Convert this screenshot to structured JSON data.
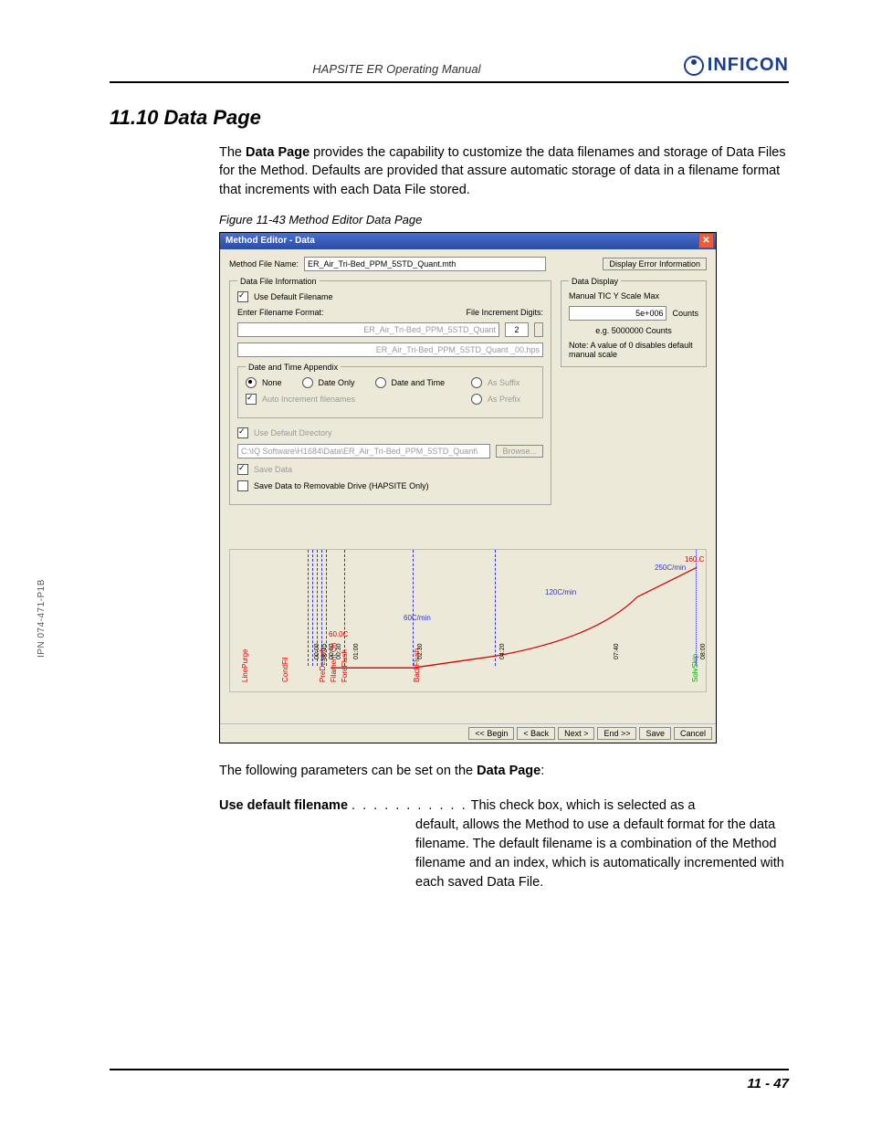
{
  "header": {
    "manual_title": "HAPSITE ER Operating Manual",
    "brand": "INFICON"
  },
  "side_label": "IPN 074-471-P1B",
  "section": {
    "number_title": "11.10  Data Page",
    "intro_1a": "The ",
    "intro_1b": "Data Page",
    "intro_1c": " provides the capability to customize the data filenames and storage of Data Files for the Method. Defaults are provided that assure automatic storage of data in a filename format that increments with each Data File stored.",
    "figure_caption": "Figure 11-43  Method Editor Data Page",
    "outro_1a": "The following parameters can be set on the ",
    "outro_1b": "Data Page",
    "outro_1c": ":"
  },
  "param": {
    "label": "Use default filename",
    "dots": ". . . . . . . . . . .",
    "desc_line1": "This check box, which is selected as a",
    "desc_rest": "default, allows the Method to use a default format for the data filename. The default filename is a combination of the Method filename and an index, which is automatically incremented with each saved Data File."
  },
  "footer": {
    "page": "11 - 47"
  },
  "win": {
    "title": "Method Editor - Data",
    "method_label": "Method File Name:",
    "method_value": "ER_Air_Tri-Bed_PPM_5STD_Quant.mth",
    "display_err_btn": "Display Error Information",
    "data_file_info": {
      "legend": "Data File Information",
      "use_default_filename": "Use Default Filename",
      "enter_filename_format": "Enter Filename Format:",
      "file_increment_digits": "File Increment Digits:",
      "increment_value": "2",
      "format_value": "ER_Air_Tri-Bed_PPM_5STD_Quant",
      "preview_value": "ER_Air_Tri-Bed_PPM_5STD_Quant _00.hps",
      "date_time_legend": "Date and Time Appendix",
      "none": "None",
      "date_only": "Date Only",
      "date_and_time": "Date and Time",
      "as_suffix": "As Suffix",
      "as_prefix": "As Prefix",
      "auto_increment": "Auto Increment filenames",
      "use_default_dir": "Use Default Directory",
      "dir_value": "C:\\IQ Software\\H1684\\Data\\ER_Air_Tri-Bed_PPM_5STD_Quant\\",
      "browse": "Browse...",
      "save_data": "Save Data",
      "save_removable": "Save Data to Removable Drive (HAPSITE Only)"
    },
    "data_display": {
      "legend": "Data Display",
      "manual_tic": "Manual TIC Y Scale Max",
      "value": "5e+006",
      "counts": "Counts",
      "eg": "e.g. 5000000 Counts",
      "note": "Note:  A value of 0 disables default manual scale"
    },
    "chart": {
      "events": {
        "line_purge": "LinePurge",
        "cond_fil": "CondFil",
        "pre_desorb": "PreDesorb",
        "filament_on": "Filament On",
        "fore_flush": "ForeFlush",
        "backflush": "BackFlush",
        "solv_skip": "SolvSkip"
      },
      "rates": {
        "r60": "60C/min",
        "r120": "120C/min",
        "r250": "250C/min"
      },
      "temps": {
        "t60": "60.0C",
        "t160": "160.C"
      },
      "times": {
        "t0000a": "00:00",
        "t0015": "00:15",
        "t0000b": "00:00",
        "t0030": "00:30",
        "t0100": "01:00",
        "t0230": "02:30",
        "t0420": "04:20",
        "t0740": "07:40",
        "t0800": "08:00"
      }
    },
    "nav": {
      "begin": "<< Begin",
      "back": "< Back",
      "next": "Next >",
      "end": "End >>",
      "save": "Save",
      "cancel": "Cancel"
    }
  }
}
